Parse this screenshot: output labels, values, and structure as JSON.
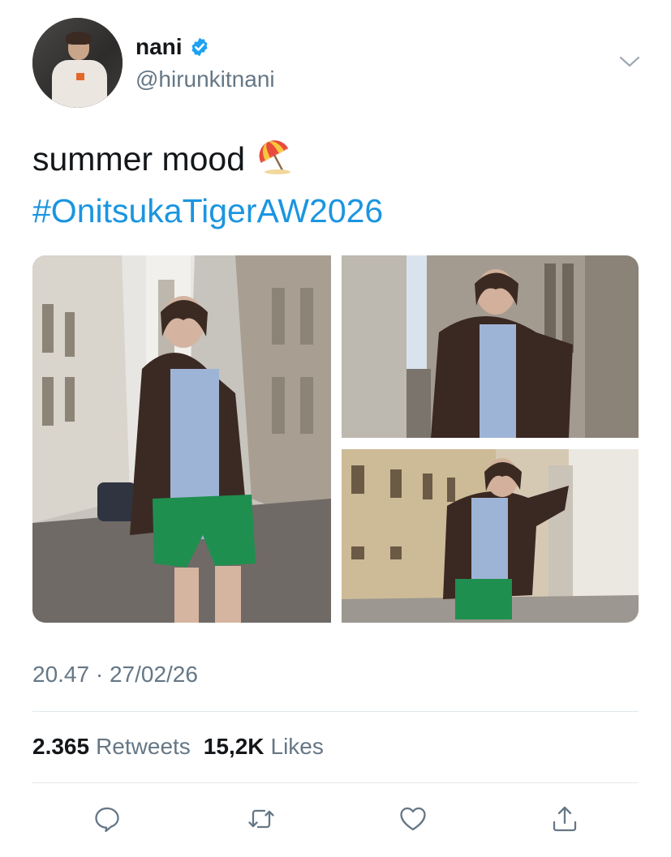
{
  "user": {
    "display_name": "nani",
    "handle": "@hirunkitnani",
    "verified": true,
    "avatar_icon": "avatar-photo"
  },
  "tweet": {
    "text": "summer mood",
    "emoji": "beach-umbrella-emoji",
    "hashtag": "#OnitsukaTigerAW2026",
    "media_count": 3,
    "media_descriptions": [],
    "timestamp": "20.47 · 27/02/26"
  },
  "stats": {
    "retweets_count": "2.365",
    "retweets_label": "Retweets",
    "likes_count": "15,2K",
    "likes_label": "Likes"
  },
  "actions": [
    {
      "name": "reply",
      "icon": "reply-icon"
    },
    {
      "name": "retweet",
      "icon": "retweet-icon"
    },
    {
      "name": "like",
      "icon": "heart-icon"
    },
    {
      "name": "share",
      "icon": "share-icon"
    }
  ],
  "colors": {
    "link": "#1b95e0",
    "secondary_text": "#657786",
    "verified_badge": "#1da1f2",
    "divider": "#e1e8ed"
  }
}
